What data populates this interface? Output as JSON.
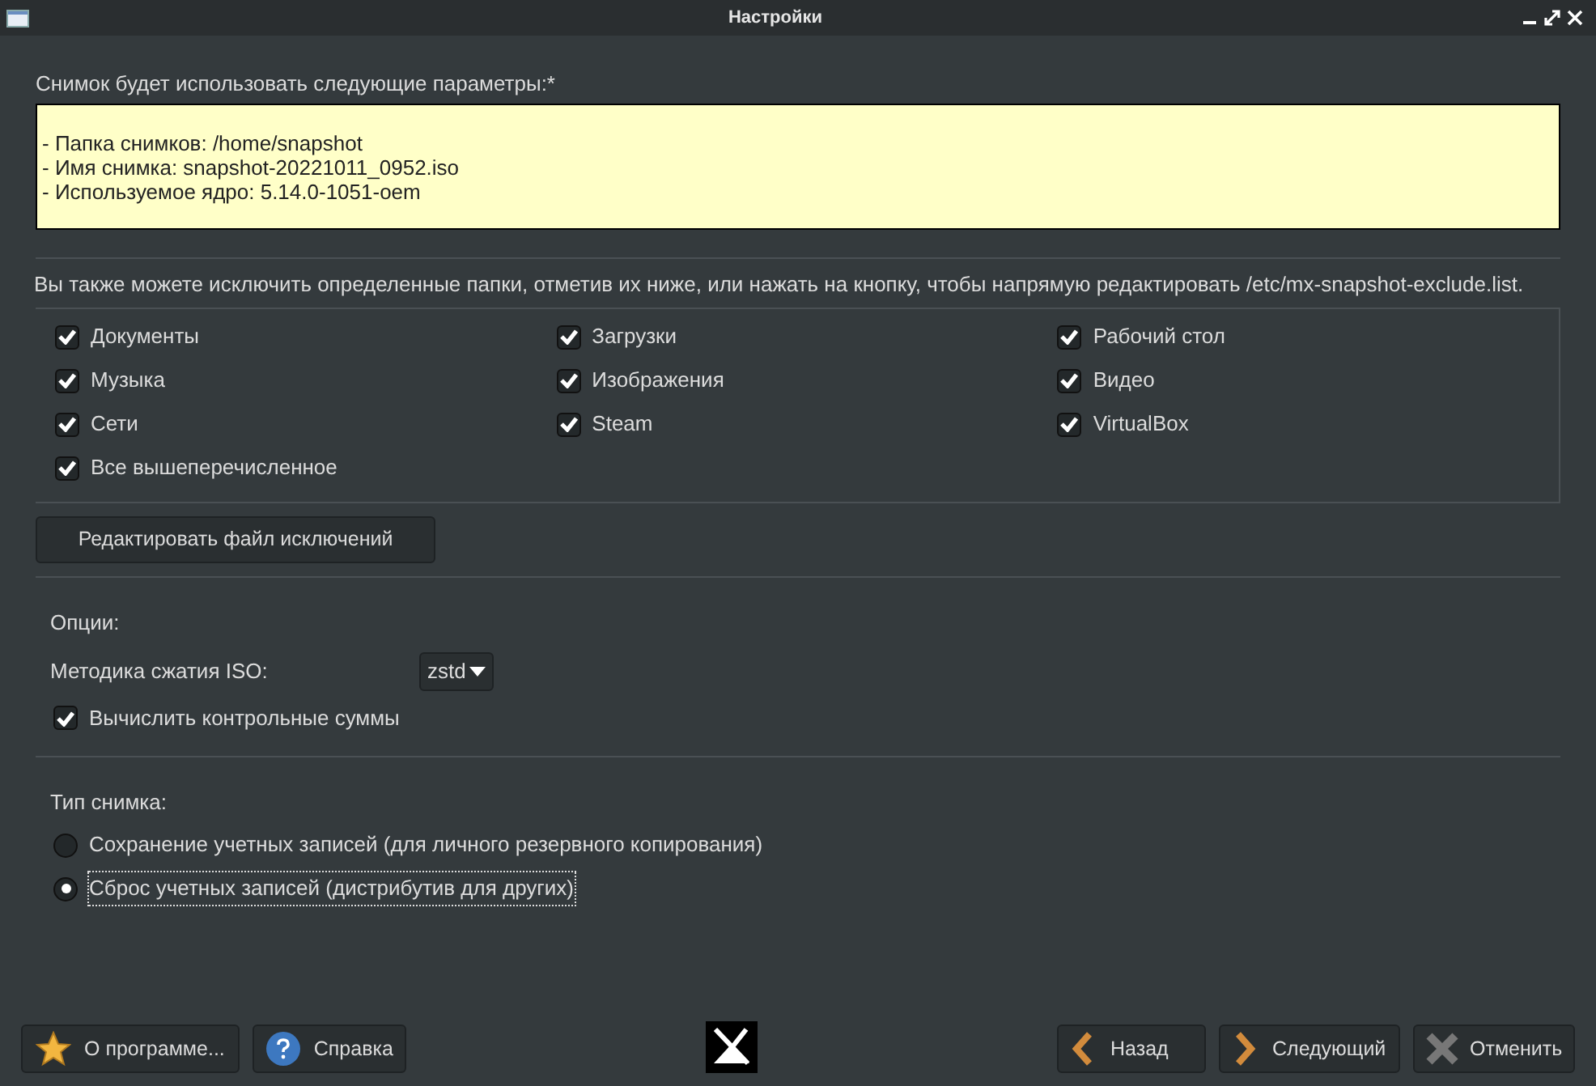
{
  "window": {
    "title": "Настройки"
  },
  "summary": {
    "label": "Снимок будет использовать следующие параметры:*",
    "lines": [
      "- Папка снимков: /home/snapshot",
      "- Имя снимка: snapshot-20221011_0952.iso",
      "- Используемое ядро: 5.14.0-1051-oem"
    ]
  },
  "exclude": {
    "label": "Вы также можете исключить определенные папки, отметив их ниже, или нажать на кнопку, чтобы напрямую редактировать /etc/mx-snapshot-exclude.list.",
    "items": [
      {
        "label": "Документы",
        "checked": true
      },
      {
        "label": "Загрузки",
        "checked": true
      },
      {
        "label": "Рабочий стол",
        "checked": true
      },
      {
        "label": "Музыка",
        "checked": true
      },
      {
        "label": "Изображения",
        "checked": true
      },
      {
        "label": "Видео",
        "checked": true
      },
      {
        "label": "Сети",
        "checked": true
      },
      {
        "label": "Steam",
        "checked": true
      },
      {
        "label": "VirtualBox",
        "checked": true
      },
      {
        "label": "Все вышеперечисленное",
        "checked": true
      }
    ],
    "edit_button": "Редактировать файл исключений"
  },
  "options": {
    "label": "Опции:",
    "compression_label": "Методика сжатия ISO:",
    "compression_value": "zstd",
    "checksum": {
      "label": "Вычислить контрольные суммы",
      "checked": true
    }
  },
  "snapshot_type": {
    "label": "Тип снимка:",
    "choices": [
      {
        "label": "Сохранение учетных записей (для личного резервного копирования)",
        "selected": false
      },
      {
        "label": "Сброс учетных записей (дистрибутив для других)",
        "selected": true
      }
    ]
  },
  "buttons": {
    "about": "О программе...",
    "help": "Справка",
    "back": "Назад",
    "next": "Следующий",
    "cancel": "Отменить"
  }
}
